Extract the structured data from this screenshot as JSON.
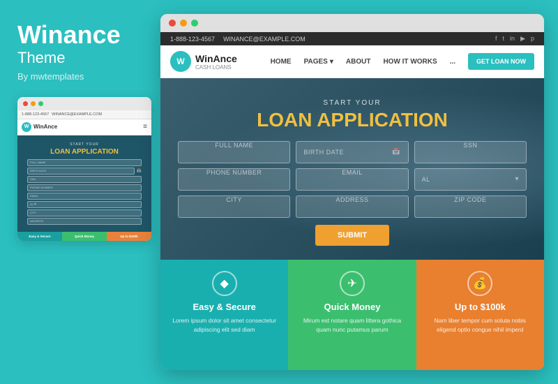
{
  "left": {
    "brand_name": "Winance",
    "brand_theme": "Theme",
    "brand_by": "By mwtemplates"
  },
  "mini_browser": {
    "topbar_phone": "1-888-123-4567",
    "topbar_email": "WINANCE@EXAMPLE.COM",
    "logo_text": "WinAnce",
    "hero_sub": "START YOUR",
    "hero_title": "LOAN APPLICATION",
    "form_fields": [
      "FULL NAME",
      "BIRTH DATE",
      "SSN",
      "PHONE NUMBER",
      "EMAIL",
      "AL",
      "CITY",
      "ADDRESS"
    ],
    "features": [
      "Easy & Secure",
      "Quick Money",
      "Up to $100k"
    ]
  },
  "main_browser": {
    "topbar_phone": "1-888-123-4567",
    "topbar_email": "WINANCE@EXAMPLE.COM",
    "nav": {
      "logo_text": "WinAnce",
      "logo_sub": "CASH LOANS",
      "links": [
        "HOME",
        "PAGES",
        "ABOUT",
        "HOW IT WORKS",
        "..."
      ],
      "cta": "GET LOAN NOW"
    },
    "hero": {
      "sub": "START YOUR",
      "title": "LOAN APPLICATION",
      "form": {
        "fields": [
          {
            "placeholder": "FULL NAME"
          },
          {
            "placeholder": "BIRTH DATE"
          },
          {
            "placeholder": "SSN"
          },
          {
            "placeholder": "PHONE NUMBER"
          },
          {
            "placeholder": "EMAIL"
          },
          {
            "placeholder": "AL"
          },
          {
            "placeholder": "CITY"
          },
          {
            "placeholder": "ADDRESS"
          },
          {
            "placeholder": "ZIP CODE"
          }
        ],
        "submit_label": "SUBMIT"
      }
    },
    "features": [
      {
        "icon": "◆",
        "title": "Easy & Secure",
        "text": "Lorem ipsum dolor sit amet consectetur adipiscing elit sed diam",
        "color": "teal"
      },
      {
        "icon": "✈",
        "title": "Quick Money",
        "text": "Mirum est notare quam littera gothica quam nunc putamus parum",
        "color": "green"
      },
      {
        "icon": "💰",
        "title": "Up to $100k",
        "text": "Nam liber tempor cum soluta nobis eligend optio congue nihil imperd",
        "color": "orange"
      }
    ]
  }
}
